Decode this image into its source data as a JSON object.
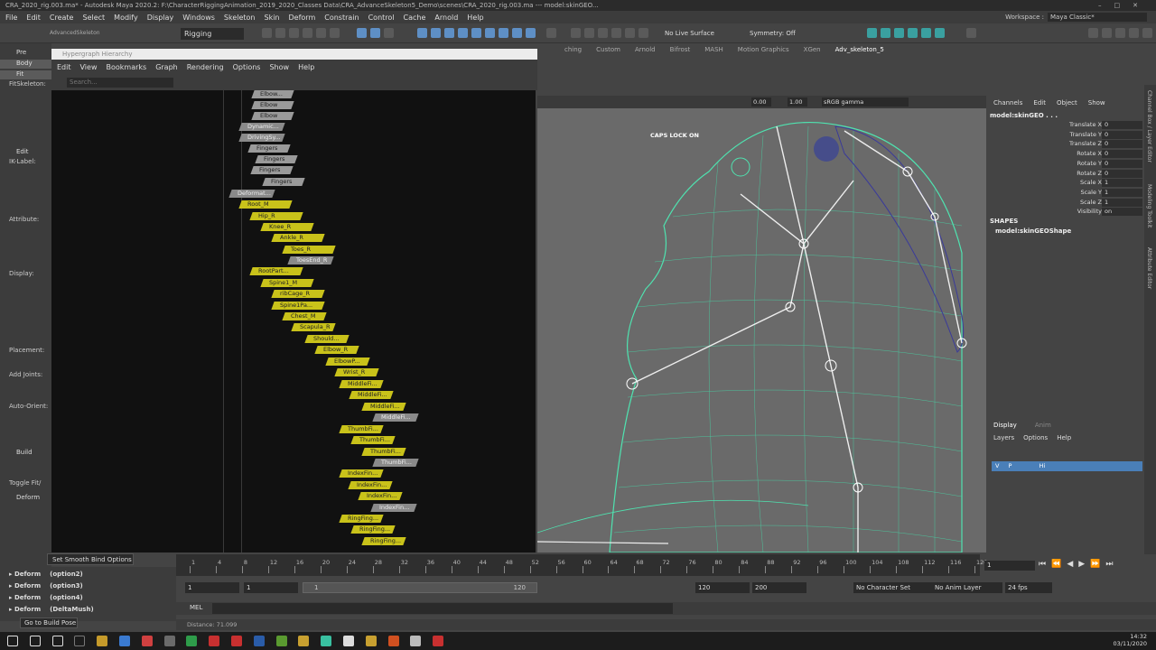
{
  "window": {
    "title": "CRA_2020_rig.003.ma* - Autodesk Maya 2020.2: F:\\CharacterRiggingAnimation_2019_2020_Classes Data\\CRA_AdvanceSkeleton5_Demo\\scenes\\CRA_2020_rig.003.ma --- model:skinGEO..."
  },
  "menubar": [
    "File",
    "Edit",
    "Create",
    "Select",
    "Modify",
    "Display",
    "Windows",
    "Skeleton",
    "Skin",
    "Deform",
    "Constrain",
    "Control",
    "Cache",
    "Arnold",
    "Help"
  ],
  "workspace": {
    "label": "Workspace :",
    "value": "Maya Classic*"
  },
  "statusline": {
    "menuset": "Rigging",
    "live": "No Live Surface",
    "symmetry": "Symmetry: Off"
  },
  "shelf_tabs": [
    "ching",
    "Custom",
    "Arnold",
    "Bifrost",
    "MASH",
    "Motion Graphics",
    "XGen",
    "Adv_skeleton_5"
  ],
  "advskel": {
    "title": "AdvancedSkeleton",
    "items": [
      "Pre",
      "Body",
      "Fit",
      "FitSkeleton:",
      "Edit",
      "IK-Label:",
      "Attribute:",
      "Display:",
      "Placement:",
      "Add Joints:",
      "Auto-Orient:",
      "Build",
      "Toggle Fit/",
      "Deform"
    ]
  },
  "hypergraph": {
    "title": "Hypergraph Hierarchy",
    "menu": [
      "Edit",
      "View",
      "Bookmarks",
      "Graph",
      "Rendering",
      "Options",
      "Show",
      "Help"
    ],
    "search_placeholder": "Search...",
    "nodes": [
      {
        "label": "Elbow...",
        "color": "gray"
      },
      {
        "label": "Elbow",
        "color": "gray"
      },
      {
        "label": "Elbow",
        "color": "gray"
      },
      {
        "label": "Dynamic...",
        "color": "dgray"
      },
      {
        "label": "DrivingSy...",
        "color": "dgray"
      },
      {
        "label": "Fingers",
        "color": "gray"
      },
      {
        "label": "Fingers",
        "color": "gray"
      },
      {
        "label": "Fingers",
        "color": "gray"
      },
      {
        "label": "Fingers",
        "color": "gray"
      },
      {
        "label": "Deformat...",
        "color": "dgray"
      },
      {
        "label": "Root_M",
        "color": "yellow"
      },
      {
        "label": "Hip_R",
        "color": "yellow"
      },
      {
        "label": "Knee_R",
        "color": "yellow"
      },
      {
        "label": "Ankle_R",
        "color": "yellow"
      },
      {
        "label": "Toes_R",
        "color": "yellow"
      },
      {
        "label": "ToesEnd_R",
        "color": "dgray"
      },
      {
        "label": "RootPart...",
        "color": "yellow"
      },
      {
        "label": "Spine1_M",
        "color": "yellow"
      },
      {
        "label": "ribCage_R",
        "color": "yellow"
      },
      {
        "label": "Spine1Pa...",
        "color": "yellow"
      },
      {
        "label": "Chest_M",
        "color": "yellow"
      },
      {
        "label": "Scapula_R",
        "color": "yellow"
      },
      {
        "label": "Should...",
        "color": "yellow"
      },
      {
        "label": "Elbow_R",
        "color": "yellow"
      },
      {
        "label": "ElbowP...",
        "color": "yellow"
      },
      {
        "label": "Wrist_R",
        "color": "yellow"
      },
      {
        "label": "MiddleFi...",
        "color": "yellow"
      },
      {
        "label": "MiddleFi...",
        "color": "yellow"
      },
      {
        "label": "MiddleFi...",
        "color": "yellow"
      },
      {
        "label": "MiddleFi...",
        "color": "dgray"
      },
      {
        "label": "ThumbFi...",
        "color": "yellow"
      },
      {
        "label": "ThumbFi...",
        "color": "yellow"
      },
      {
        "label": "ThumbFi...",
        "color": "yellow"
      },
      {
        "label": "ThumbFi...",
        "color": "dgray"
      },
      {
        "label": "IndexFin...",
        "color": "yellow"
      },
      {
        "label": "IndexFin...",
        "color": "yellow"
      },
      {
        "label": "IndexFin...",
        "color": "yellow"
      },
      {
        "label": "IndexFin...",
        "color": "dgray"
      },
      {
        "label": "RingFing...",
        "color": "yellow"
      },
      {
        "label": "RingFing...",
        "color": "yellow"
      },
      {
        "label": "RingFing...",
        "color": "yellow"
      }
    ]
  },
  "viewport": {
    "field1": "0.00",
    "field2": "1.00",
    "colorspace": "sRGB gamma",
    "caps": "CAPS LOCK ON"
  },
  "channelbox": {
    "menu": [
      "Channels",
      "Edit",
      "Object",
      "Show"
    ],
    "object": "model:skinGEO . . .",
    "attributes": [
      {
        "name": "Translate X",
        "value": "0"
      },
      {
        "name": "Translate Y",
        "value": "0"
      },
      {
        "name": "Translate Z",
        "value": "0"
      },
      {
        "name": "Rotate X",
        "value": "0"
      },
      {
        "name": "Rotate Y",
        "value": "0"
      },
      {
        "name": "Rotate Z",
        "value": "0"
      },
      {
        "name": "Scale X",
        "value": "1"
      },
      {
        "name": "Scale Y",
        "value": "1"
      },
      {
        "name": "Scale Z",
        "value": "1"
      },
      {
        "name": "Visibility",
        "value": "on"
      }
    ],
    "shapes_header": "SHAPES",
    "shape": "model:skinGEOShape"
  },
  "layers": {
    "tabs": [
      "Display",
      "Anim"
    ],
    "menu": [
      "Layers",
      "Options",
      "Help"
    ],
    "row": {
      "v": "V",
      "p": "P",
      "name": "Hi"
    }
  },
  "rightstrip": [
    "Channel Box / Layer Editor",
    "Modeling Toolkit",
    "Attribute Editor"
  ],
  "timeline": {
    "ticks": [
      "1",
      "4",
      "8",
      "12",
      "16",
      "20",
      "24",
      "28",
      "32",
      "36",
      "40",
      "44",
      "48",
      "52",
      "56",
      "60",
      "64",
      "68",
      "72",
      "76",
      "80",
      "84",
      "88",
      "92",
      "96",
      "100",
      "104",
      "108",
      "112",
      "116",
      "120"
    ],
    "current": "1"
  },
  "range": {
    "start": "1",
    "start2": "1",
    "slider_start": "1",
    "slider_end": "120",
    "end": "120",
    "end2": "200",
    "character_set": "No Character Set",
    "anim_layer": "No Anim Layer",
    "fps": "24 fps"
  },
  "cmdline": {
    "label": "MEL"
  },
  "helpline": {
    "text": "Distance: 71.099"
  },
  "deform_list": [
    {
      "name": "Deform",
      "opt": "(option2)"
    },
    {
      "name": "Deform",
      "opt": "(option3)"
    },
    {
      "name": "Deform",
      "opt": "(option4)"
    },
    {
      "name": "Deform",
      "opt": "(DeltaMush)"
    }
  ],
  "tooltips": {
    "smooth_bind": "Set Smooth Bind Options",
    "build_pose": "Go to Build Pose"
  },
  "clock": {
    "time": "14:32",
    "date": "03/11/2020"
  }
}
